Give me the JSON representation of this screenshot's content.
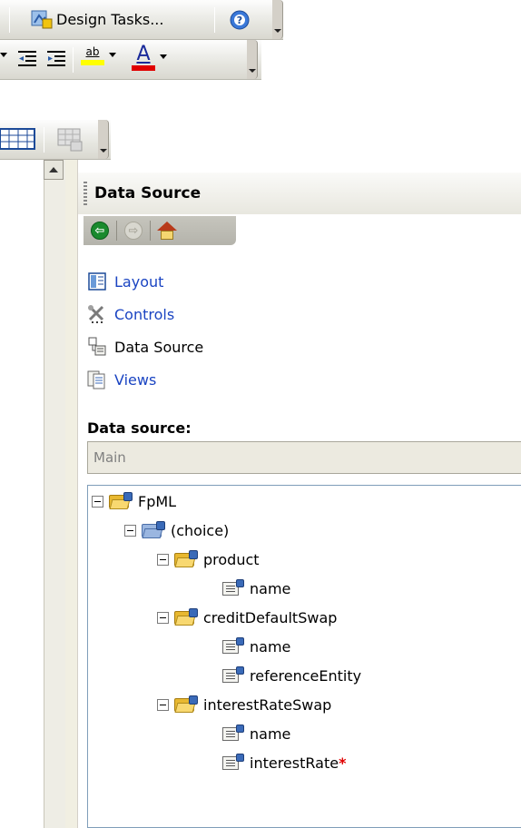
{
  "toolbar": {
    "design_tasks_label": "Design Tasks...",
    "font_color_glyph": "A",
    "highlight_glyph": "ab"
  },
  "pane": {
    "title": "Data Source",
    "nav": {
      "back": "back-icon",
      "forward": "forward-icon",
      "home": "home-icon"
    },
    "links": [
      {
        "label": "Layout",
        "icon": "layout-icon",
        "is_link": true
      },
      {
        "label": "Controls",
        "icon": "controls-icon",
        "is_link": true
      },
      {
        "label": "Data Source",
        "icon": "data-source-icon",
        "is_link": false
      },
      {
        "label": "Views",
        "icon": "views-icon",
        "is_link": true
      }
    ],
    "data_source_label": "Data source:",
    "data_source_value": "Main"
  },
  "tree": {
    "nodes": [
      {
        "label": "FpML",
        "type": "group"
      },
      {
        "label": "(choice)",
        "type": "choice"
      },
      {
        "label": "product",
        "type": "group"
      },
      {
        "label": "name",
        "type": "field"
      },
      {
        "label": "creditDefaultSwap",
        "type": "group"
      },
      {
        "label": "name",
        "type": "field"
      },
      {
        "label": "referenceEntity",
        "type": "field"
      },
      {
        "label": "interestRateSwap",
        "type": "group"
      },
      {
        "label": "name",
        "type": "field"
      },
      {
        "label": "interestRate",
        "type": "field",
        "required_marker": "*"
      }
    ]
  },
  "colors": {
    "link": "#1a44c2",
    "required": "#e00000",
    "font_color_bar": "#e00000",
    "highlight_bar": "#ffff00"
  }
}
